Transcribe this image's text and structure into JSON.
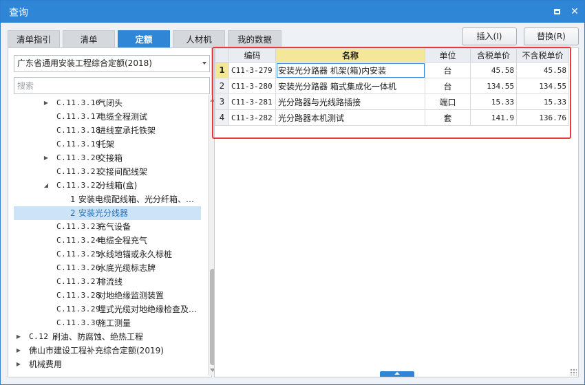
{
  "window": {
    "title": "查询",
    "maximize_icon": "maximize-icon",
    "close_glyph": "✕"
  },
  "tabs": [
    {
      "label": "清单指引",
      "active": false
    },
    {
      "label": "清单",
      "active": false
    },
    {
      "label": "定额",
      "active": true
    },
    {
      "label": "人材机",
      "active": false
    },
    {
      "label": "我的数据",
      "active": false
    }
  ],
  "actions": {
    "insert_label": "插入(I)",
    "replace_label": "替换(R)"
  },
  "left": {
    "quota_db": "广东省通用安装工程综合定额(2018)",
    "search_placeholder": "搜索",
    "tree": [
      {
        "arrow": "▶",
        "code": "C.11.3.16",
        "label": "气闭头"
      },
      {
        "arrow": "",
        "code": "C.11.3.17",
        "label": "电缆全程测试"
      },
      {
        "arrow": "",
        "code": "C.11.3.18",
        "label": "进线室承托铁架"
      },
      {
        "arrow": "",
        "code": "C.11.3.19",
        "label": "托架"
      },
      {
        "arrow": "▶",
        "code": "C.11.3.20",
        "label": "交接箱"
      },
      {
        "arrow": "",
        "code": "C.11.3.21",
        "label": "交接间配线架"
      },
      {
        "arrow": "◢",
        "code": "C.11.3.22",
        "label": "分线箱(盒)"
      },
      {
        "arrow": "",
        "code": "1",
        "label": "安装电缆配线箱、光分纤箱、…"
      },
      {
        "arrow": "",
        "code": "2",
        "label": "安装光分线器"
      },
      {
        "arrow": "",
        "code": "C.11.3.23",
        "label": "充气设备"
      },
      {
        "arrow": "",
        "code": "C.11.3.24",
        "label": "电缆全程充气"
      },
      {
        "arrow": "",
        "code": "C.11.3.25",
        "label": "水线地锚或永久标桩"
      },
      {
        "arrow": "",
        "code": "C.11.3.26",
        "label": "水底光缆标志牌"
      },
      {
        "arrow": "",
        "code": "C.11.3.27",
        "label": "排流线"
      },
      {
        "arrow": "",
        "code": "C.11.3.28",
        "label": "对地绝缘监测装置"
      },
      {
        "arrow": "",
        "code": "C.11.3.29",
        "label": "埋式光缆对地绝缘检查及…"
      },
      {
        "arrow": "",
        "code": "C.11.3.30",
        "label": "施工测量"
      },
      {
        "arrow": "▶",
        "code": "C.12",
        "label": "刷油、防腐蚀、绝热工程"
      },
      {
        "arrow": "▶",
        "code": "",
        "label": "佛山市建设工程补充综合定额(2019)"
      },
      {
        "arrow": "▶",
        "code": "",
        "label": "机械费用"
      }
    ]
  },
  "table": {
    "headers": {
      "code": "编码",
      "name": "名称",
      "unit": "单位",
      "price_tax": "含税单价",
      "price_notax": "不含税单价"
    },
    "rows": [
      {
        "idx": "1",
        "code": "C11-3-279",
        "name": "安装光分路器 机架(箱)内安装",
        "unit": "台",
        "price_tax": "45.58",
        "price_notax": "45.58"
      },
      {
        "idx": "2",
        "code": "C11-3-280",
        "name": "安装光分路器 箱式集成化一体机",
        "unit": "台",
        "price_tax": "134.55",
        "price_notax": "134.55"
      },
      {
        "idx": "3",
        "code": "C11-3-281",
        "name": "光分路器与光线路插接",
        "unit": "端口",
        "price_tax": "15.33",
        "price_notax": "15.33"
      },
      {
        "idx": "4",
        "code": "C11-3-282",
        "name": "光分路器本机测试",
        "unit": "套",
        "price_tax": "141.9",
        "price_notax": "136.76"
      }
    ]
  },
  "colors": {
    "accent": "#2f86d6",
    "highlight": "#f4e79a",
    "annotation": "#e53b3b",
    "selection": "#cde3f7"
  }
}
